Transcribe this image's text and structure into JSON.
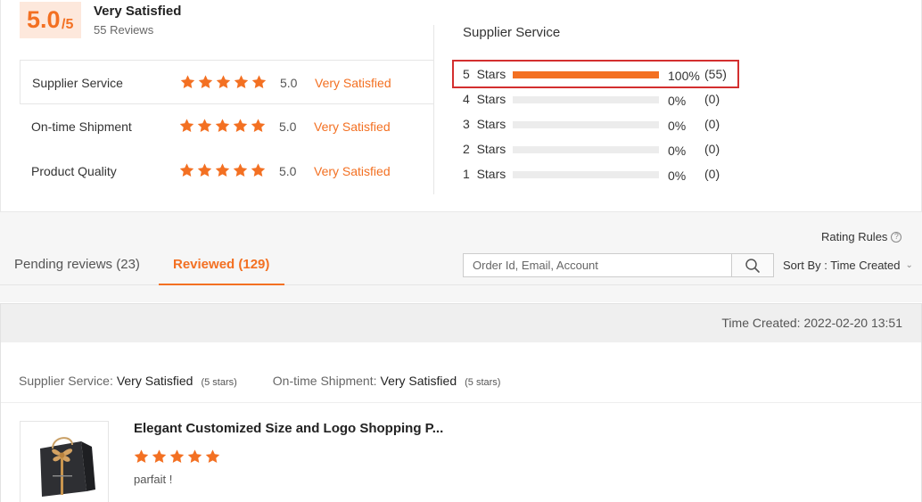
{
  "summary": {
    "score": "5.0",
    "score_out_of": "/5",
    "overall_label": "Very Satisfied",
    "review_count": "55 Reviews",
    "dimensions": [
      {
        "name": "Supplier Service",
        "score": "5.0",
        "satisfaction": "Very Satisfied",
        "stars": 5
      },
      {
        "name": "On-time Shipment",
        "score": "5.0",
        "satisfaction": "Very Satisfied",
        "stars": 5
      },
      {
        "name": "Product Quality",
        "score": "5.0",
        "satisfaction": "Very Satisfied",
        "stars": 5
      }
    ],
    "distribution": {
      "title": "Supplier Service",
      "rows": [
        {
          "label": "5  Stars",
          "fill_percent": 100,
          "percent": "100%",
          "count": "(55)"
        },
        {
          "label": "4  Stars",
          "fill_percent": 0,
          "percent": "0%",
          "count": "(0)"
        },
        {
          "label": "3  Stars",
          "fill_percent": 0,
          "percent": "0%",
          "count": "(0)"
        },
        {
          "label": "2  Stars",
          "fill_percent": 0,
          "percent": "0%",
          "count": "(0)"
        },
        {
          "label": "1  Stars",
          "fill_percent": 0,
          "percent": "0%",
          "count": "(0)"
        }
      ]
    }
  },
  "toolbar": {
    "rating_rules": "Rating Rules",
    "tabs": [
      {
        "label": "Pending reviews (23)"
      },
      {
        "label": "Reviewed (129)"
      }
    ],
    "search_placeholder": "Order Id, Email, Account",
    "sort_label": "Sort By : Time Created"
  },
  "review": {
    "time_created": "Time Created: 2022-02-20 13:51",
    "supplier_service_label": "Supplier Service:",
    "supplier_service_value": "Very Satisfied",
    "supplier_service_stars": "(5 stars)",
    "shipment_label": "On-time Shipment:",
    "shipment_value": "Very Satisfied",
    "shipment_stars": "(5 stars)",
    "product_title": "Elegant Customized Size and Logo Shopping P...",
    "product_stars": 5,
    "comment": "parfait !"
  },
  "colors": {
    "accent": "#f37022",
    "highlight_border": "#d32f2f",
    "score_bg": "#fde8dc"
  },
  "icons": [
    "star-icon",
    "search-icon",
    "help-icon",
    "chevron-down-icon"
  ]
}
